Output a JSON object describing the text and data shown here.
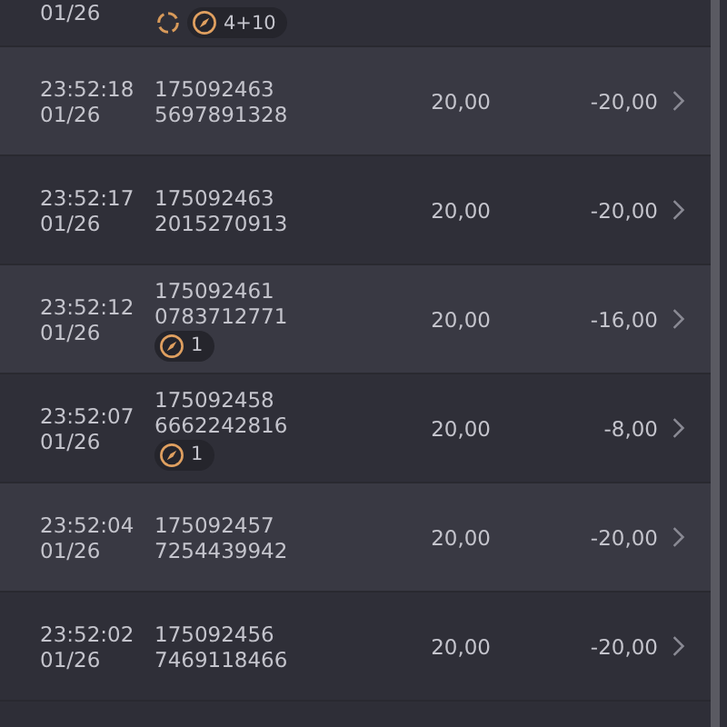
{
  "rows": [
    {
      "time": "",
      "date": "01/26",
      "ids": [],
      "amount": "",
      "net": "",
      "badges": [
        {
          "kind": "refresh"
        },
        {
          "kind": "compass",
          "count": "4+10"
        }
      ]
    },
    {
      "time": "23:52:18",
      "date": "01/26",
      "ids": [
        "175092463",
        "5697891328"
      ],
      "amount": "20,00",
      "net": "-20,00",
      "badges": []
    },
    {
      "time": "23:52:17",
      "date": "01/26",
      "ids": [
        "175092463",
        "2015270913"
      ],
      "amount": "20,00",
      "net": "-20,00",
      "badges": []
    },
    {
      "time": "23:52:12",
      "date": "01/26",
      "ids": [
        "175092461",
        "0783712771"
      ],
      "amount": "20,00",
      "net": "-16,00",
      "badges": [
        {
          "kind": "compass",
          "count": "1"
        }
      ]
    },
    {
      "time": "23:52:07",
      "date": "01/26",
      "ids": [
        "175092458",
        "6662242816"
      ],
      "amount": "20,00",
      "net": "-8,00",
      "badges": [
        {
          "kind": "compass",
          "count": "1"
        }
      ]
    },
    {
      "time": "23:52:04",
      "date": "01/26",
      "ids": [
        "175092457",
        "7254439942"
      ],
      "amount": "20,00",
      "net": "-20,00",
      "badges": []
    },
    {
      "time": "23:52:02",
      "date": "01/26",
      "ids": [
        "175092456",
        "7469118466"
      ],
      "amount": "20,00",
      "net": "-20,00",
      "badges": []
    }
  ]
}
